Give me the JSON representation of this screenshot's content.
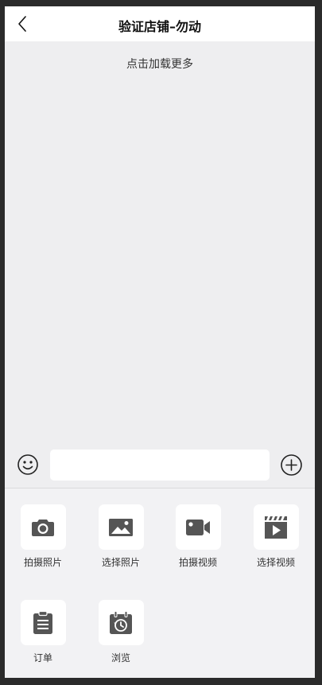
{
  "header": {
    "title": "验证店铺–勿动",
    "back_icon": "chevron-left-icon"
  },
  "messages": {
    "load_more": "点击加载更多"
  },
  "input_bar": {
    "emoji_icon": "smiley-icon",
    "input_value": "",
    "input_placeholder": "",
    "plus_icon": "plus-circle-icon"
  },
  "panel": {
    "tools": [
      {
        "label": "拍摄照片",
        "icon": "camera-icon"
      },
      {
        "label": "选择照片",
        "icon": "image-icon"
      },
      {
        "label": "拍摄视频",
        "icon": "video-camera-icon"
      },
      {
        "label": "选择视频",
        "icon": "video-clip-icon"
      },
      {
        "label": "订单",
        "icon": "clipboard-icon"
      },
      {
        "label": "浏览",
        "icon": "history-calendar-icon"
      }
    ]
  },
  "colors": {
    "icon": "#555555",
    "background": "#eeeef0",
    "header": "#ffffff"
  }
}
